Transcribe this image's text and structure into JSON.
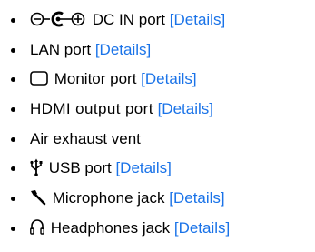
{
  "ports": [
    {
      "icon": "dc-polarity-icon",
      "label": "DC IN port",
      "link": "[Details]"
    },
    {
      "icon": "",
      "label": "LAN port",
      "link": "[Details]"
    },
    {
      "icon": "monitor-icon",
      "label": "Monitor port",
      "link": "[Details]"
    },
    {
      "icon": "",
      "label": "HDMI output port",
      "link": "[Details]"
    },
    {
      "icon": "",
      "label": "Air exhaust vent",
      "link": ""
    },
    {
      "icon": "usb-icon",
      "label": "USB port",
      "link": "[Details]"
    },
    {
      "icon": "microphone-icon",
      "label": "Microphone jack",
      "link": "[Details]"
    },
    {
      "icon": "headphones-icon",
      "label": "Headphones jack",
      "link": "[Details]"
    }
  ],
  "colors": {
    "link": "#1a73e8",
    "text": "#000000"
  }
}
